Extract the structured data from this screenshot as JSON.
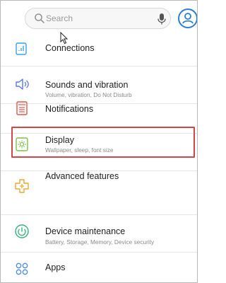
{
  "search": {
    "placeholder": "Search"
  },
  "items": [
    {
      "title": "Connections",
      "subtitle": "",
      "icon": "connections-icon"
    },
    {
      "title": "Sounds and vibration",
      "subtitle": "Volume, vibration, Do Not Disturb",
      "icon": "speaker-icon"
    },
    {
      "title": "Notifications",
      "subtitle": "",
      "icon": "notifications-icon"
    },
    {
      "title": "Display",
      "subtitle": "Wallpaper, sleep, font size",
      "icon": "display-icon"
    },
    {
      "title": "Advanced features",
      "subtitle": "",
      "icon": "advanced-features-icon"
    },
    {
      "title": "Device maintenance",
      "subtitle": "Battery, Storage, Memory, Device security",
      "icon": "device-maintenance-icon"
    },
    {
      "title": "Apps",
      "subtitle": "",
      "icon": "apps-icon"
    }
  ],
  "colors": {
    "connections": "#35a3e6",
    "sounds": "#5a78e8",
    "notifications": "#e0584d",
    "display": "#7cbf4b",
    "advanced": "#e8a83a",
    "maintenance": "#35b37e",
    "apps": "#4d8be6",
    "highlight": "#d64545"
  }
}
